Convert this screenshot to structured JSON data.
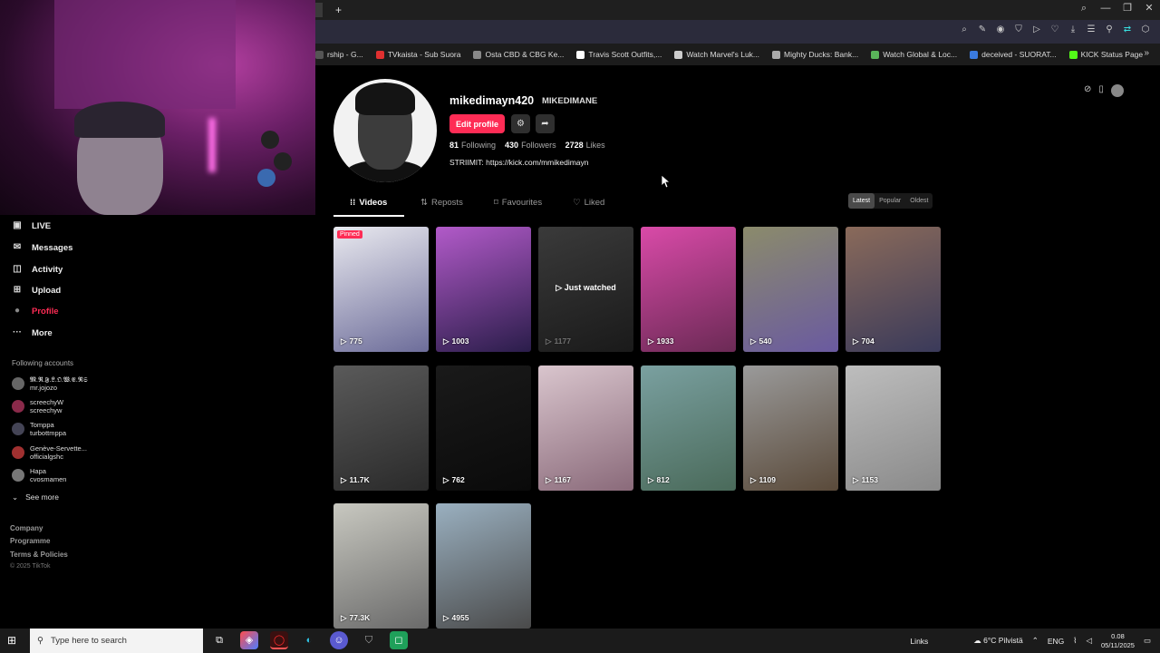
{
  "browser": {
    "new_tab": "+",
    "window_controls": [
      "⌕",
      "—",
      "❐",
      "✕"
    ],
    "toolbar_icons": [
      "⌕",
      "✎",
      "◉",
      "⛉",
      "▷",
      "♡",
      "⤓",
      "☰",
      "⚲",
      "⇄",
      "⬡"
    ],
    "bookmarks": [
      {
        "label": "rship - G...",
        "color": "#555"
      },
      {
        "label": "TVkaista - Sub Suora",
        "color": "#e03030"
      },
      {
        "label": "Osta CBD & CBG Ke...",
        "color": "#888"
      },
      {
        "label": "Travis Scott Outfits,...",
        "color": "#fff"
      },
      {
        "label": "Watch Marvel's Luk...",
        "color": "#ccc"
      },
      {
        "label": "Mighty Ducks: Bank...",
        "color": "#aaa"
      },
      {
        "label": "Watch Global & Loc...",
        "color": "#5ab55a"
      },
      {
        "label": "deceived - SUORAT...",
        "color": "#3a7be0"
      },
      {
        "label": "KICK Status Page",
        "color": "#53fc18"
      }
    ],
    "bookmarks_more": "»"
  },
  "sidebar": {
    "nav": [
      {
        "label": "LIVE",
        "icon": "▣"
      },
      {
        "label": "Messages",
        "icon": "✉"
      },
      {
        "label": "Activity",
        "icon": "◫"
      },
      {
        "label": "Upload",
        "icon": "⊞"
      },
      {
        "label": "Profile",
        "icon": "●"
      },
      {
        "label": "More",
        "icon": "···"
      }
    ],
    "following_label": "Following accounts",
    "accounts": [
      {
        "name": "𝕸.𝕽.𝕱.𝕷.𝕺.𝖂.𝕰.𝕽𝕾",
        "handle": "mr.jojozo"
      },
      {
        "name": "screechyW",
        "handle": "screechyw"
      },
      {
        "name": "Tomppa",
        "handle": "turbottmppa"
      },
      {
        "name": "Genève-Servette...",
        "handle": "officialgshc"
      },
      {
        "name": "Hapa",
        "handle": "cvosmamen"
      }
    ],
    "see_more": "See more",
    "footer": [
      "Company",
      "Programme",
      "Terms & Policies"
    ],
    "copyright": "© 2025 TikTok"
  },
  "profile": {
    "username": "mikedimayn420",
    "nickname": "MIKEDIMANE",
    "edit_label": "Edit profile",
    "following_count": "81",
    "following_label": "Following",
    "followers_count": "430",
    "followers_label": "Followers",
    "likes_count": "2728",
    "likes_label": "Likes",
    "bio": "STRIIMIT: https://kick.com/mmikedimayn"
  },
  "tabs": [
    {
      "label": "Videos",
      "icon": "⁞⁞"
    },
    {
      "label": "Reposts",
      "icon": "⇅"
    },
    {
      "label": "Favourites",
      "icon": "⌑"
    },
    {
      "label": "Liked",
      "icon": "♡"
    }
  ],
  "sort": [
    "Latest",
    "Popular",
    "Oldest"
  ],
  "videos": [
    {
      "views": "775",
      "pinned": "Pinned",
      "colors": [
        "#e9e9ef",
        "#6d6d9a"
      ]
    },
    {
      "views": "1003",
      "colors": [
        "#b25ac9",
        "#2a1d4a"
      ]
    },
    {
      "views": "1177",
      "watched": "Just watched",
      "colors": [
        "#3a3a3a",
        "#1a1a1a"
      ]
    },
    {
      "views": "1933",
      "colors": [
        "#d94aa8",
        "#6b2a55"
      ]
    },
    {
      "views": "540",
      "colors": [
        "#8b8b6b",
        "#6a5aa0"
      ]
    },
    {
      "views": "704",
      "colors": [
        "#8a6a5a",
        "#3a3a5a"
      ]
    },
    {
      "views": "11.7K",
      "colors": [
        "#5a5a5a",
        "#2a2a2a"
      ]
    },
    {
      "views": "762",
      "colors": [
        "#1a1a1a",
        "#0a0a0a"
      ]
    },
    {
      "views": "1167",
      "colors": [
        "#d9c5cd",
        "#8a6a7a"
      ]
    },
    {
      "views": "812",
      "colors": [
        "#7aa0a0",
        "#4a6a5a"
      ]
    },
    {
      "views": "1109",
      "colors": [
        "#9a9a9a",
        "#5a4a3a"
      ]
    },
    {
      "views": "1153",
      "colors": [
        "#bdbdbd",
        "#8a8a8a"
      ]
    },
    {
      "views": "77.3K",
      "colors": [
        "#c8c8c0",
        "#6a6a6a"
      ]
    },
    {
      "views": "4955",
      "colors": [
        "#9ab0c0",
        "#4a4a4a"
      ]
    }
  ],
  "taskbar": {
    "search_placeholder": "Type here to search",
    "links": "Links",
    "weather": "6°C Pilvistä",
    "lang": "ENG",
    "time": "0.08",
    "date": "05/11/2025"
  }
}
